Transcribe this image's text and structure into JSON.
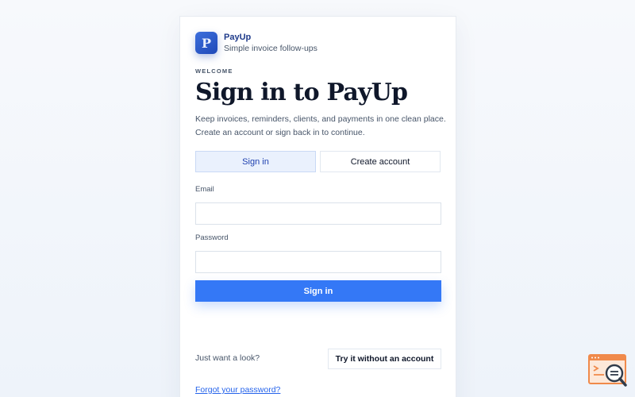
{
  "brand": {
    "logo_letter": "P",
    "name": "PayUp",
    "tagline": "Simple invoice follow-ups"
  },
  "hero": {
    "eyebrow": "WELCOME",
    "title": "Sign in to PayUp",
    "intro_line1": "Keep invoices, reminders, clients, and payments in one clean place.",
    "intro_line2": "Create an account or sign back in to continue."
  },
  "tabs": [
    {
      "label": "Sign in",
      "active": true
    },
    {
      "label": "Create account",
      "active": false
    }
  ],
  "form": {
    "email_label": "Email",
    "email_value": "",
    "password_label": "Password",
    "password_value": "",
    "submit_label": "Sign in"
  },
  "guest": {
    "prompt": "Just want a look?",
    "button_label": "Try it without an account"
  },
  "forgot_link": "Forgot your password?",
  "colors": {
    "accent": "#3478f6",
    "brand_dark": "#1e3a8a",
    "active_tab_bg": "#eaf1fd",
    "badge_orange": "#f08a4b"
  },
  "icons": {
    "corner": "search-browser-icon"
  }
}
